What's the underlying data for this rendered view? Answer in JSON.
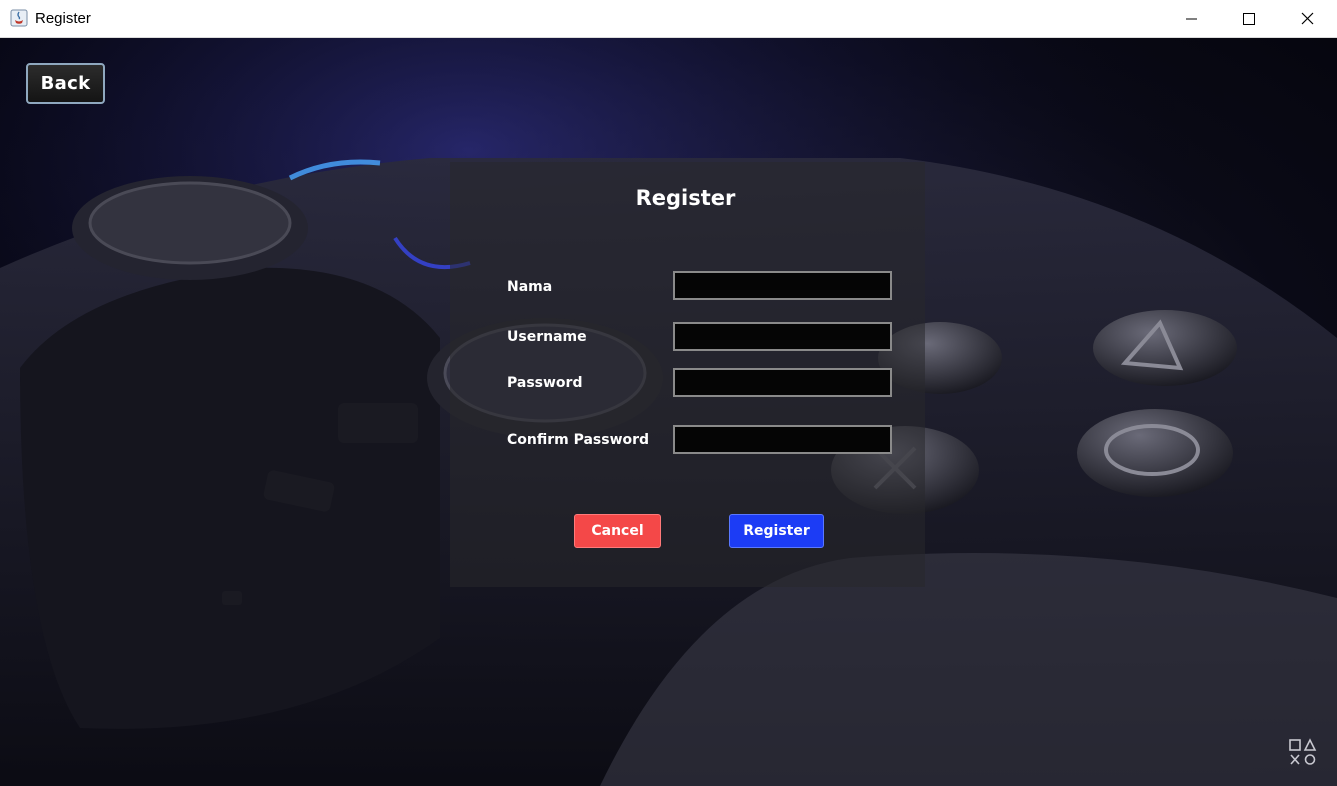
{
  "window": {
    "title": "Register",
    "controls": [
      "minimize-icon",
      "maximize-icon",
      "close-icon"
    ]
  },
  "toolbar": {
    "back_label": "Back"
  },
  "form": {
    "title": "Register",
    "fields": [
      {
        "label": "Nama",
        "value": ""
      },
      {
        "label": "Username",
        "value": ""
      },
      {
        "label": "Password",
        "value": ""
      },
      {
        "label": "Confirm Password",
        "value": ""
      }
    ],
    "cancel_label": "Cancel",
    "register_label": "Register"
  },
  "colors": {
    "cancel": "#f44848",
    "register": "#1c3cf5",
    "panel": "#28282c"
  },
  "background": {
    "image": "game-controller-illustration",
    "logo": "playstation-symbols-icon"
  }
}
